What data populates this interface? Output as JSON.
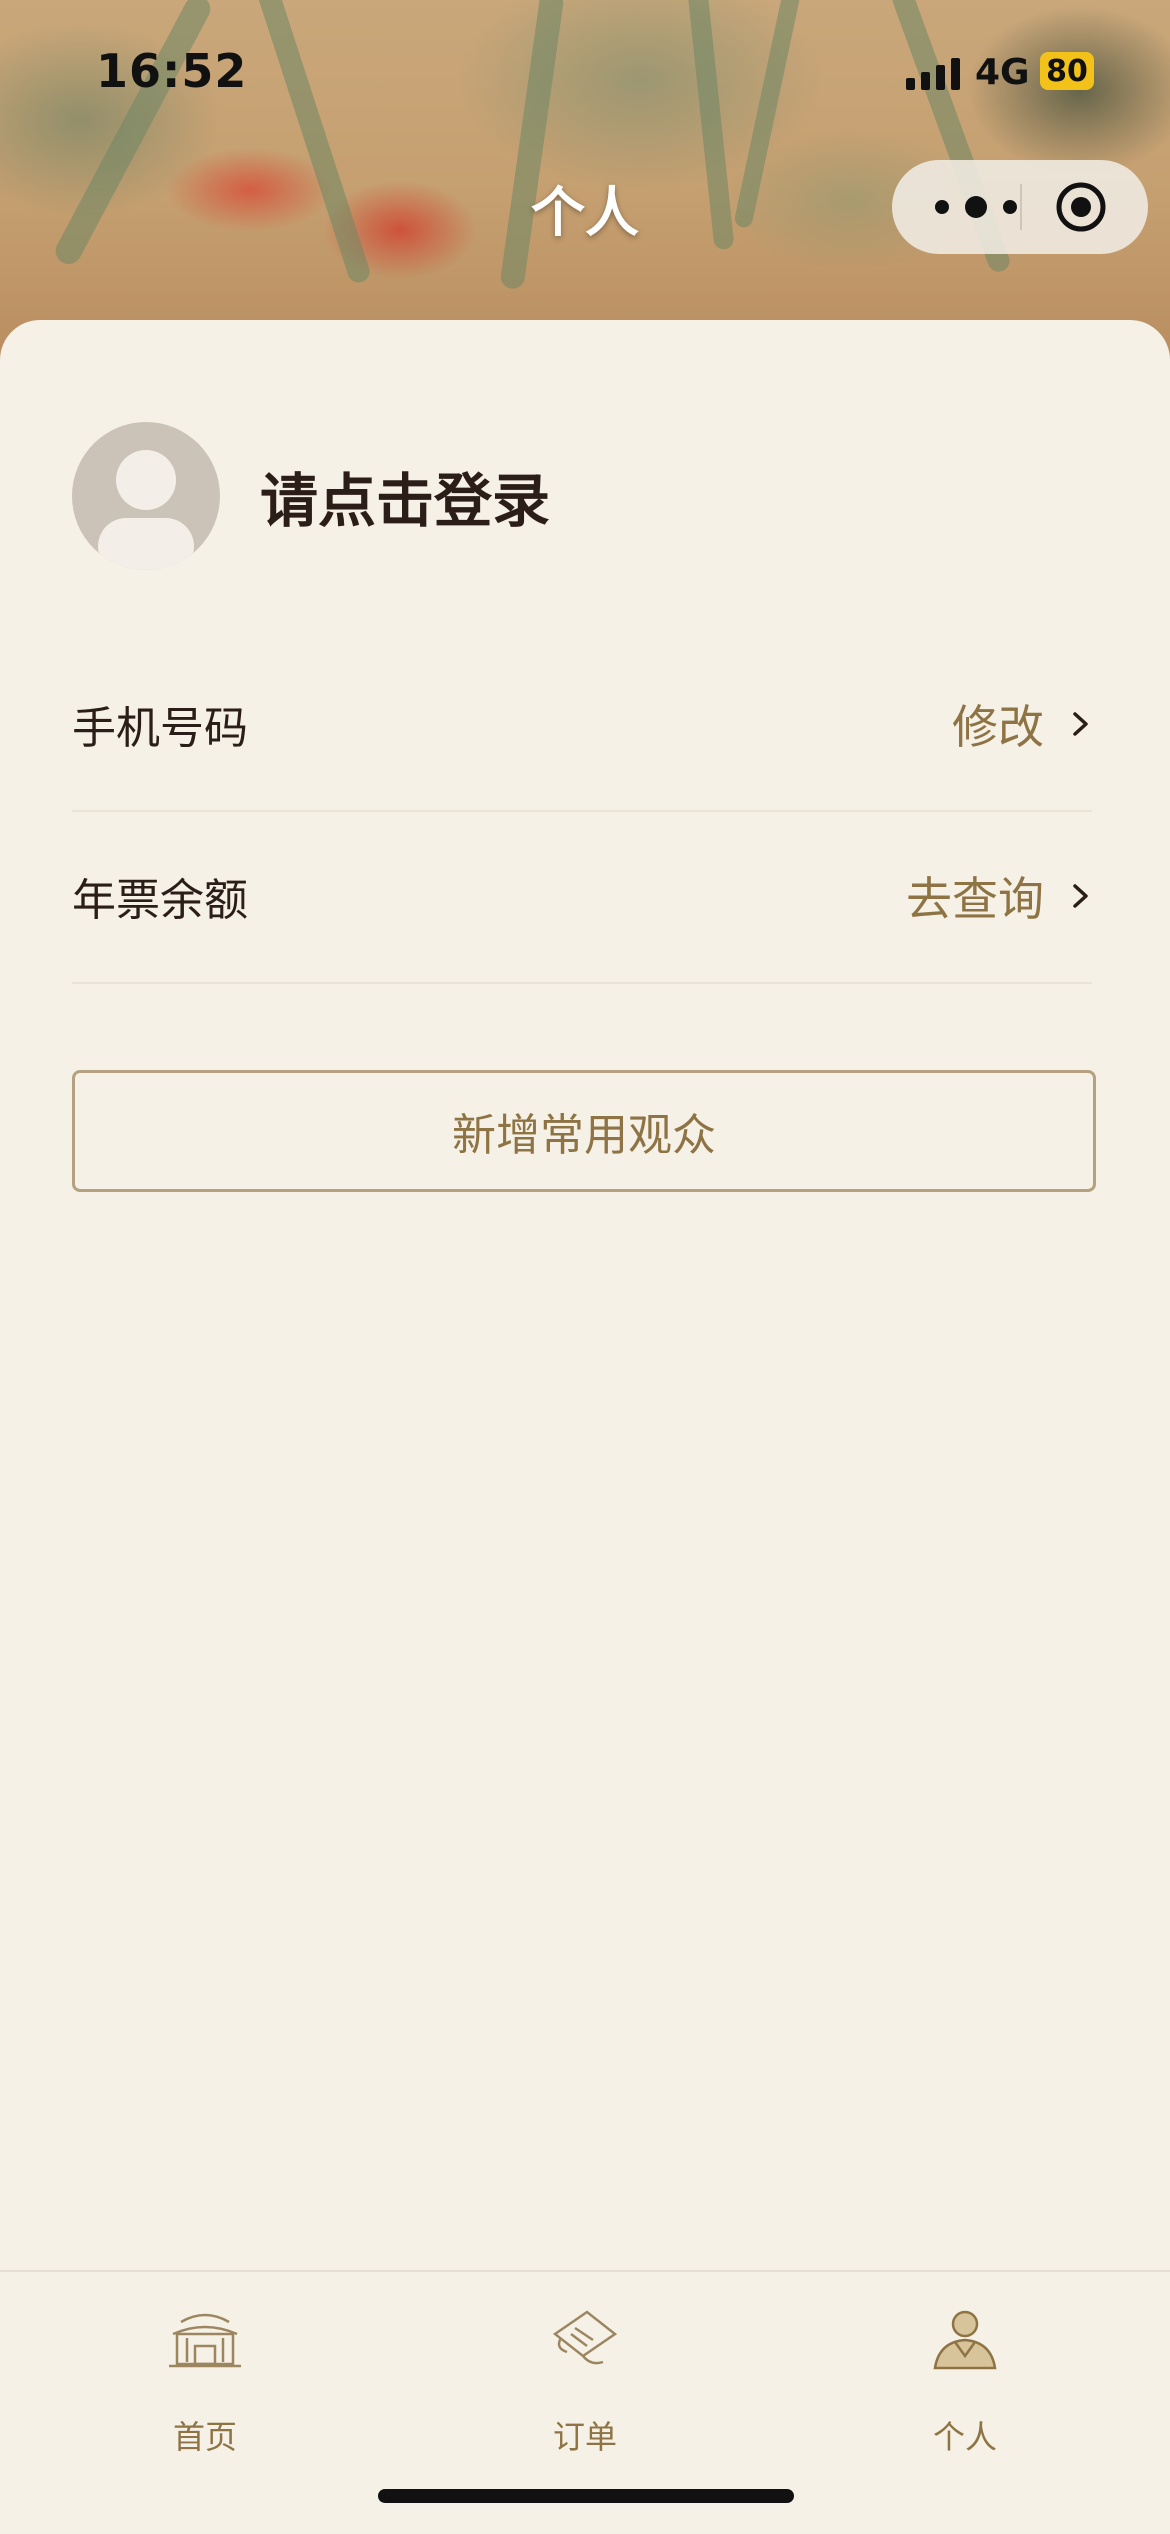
{
  "status_bar": {
    "time": "16:52",
    "network": "4G",
    "battery": "80"
  },
  "nav": {
    "title": "个人",
    "capsule": {
      "more_icon": "more-dots-icon",
      "close_icon": "target-circle-icon"
    }
  },
  "profile": {
    "login_text": "请点击登录",
    "avatar_icon": "default-avatar-icon"
  },
  "rows": [
    {
      "label": "手机号码",
      "action": "修改"
    },
    {
      "label": "年票余额",
      "action": "去查询"
    }
  ],
  "add_button": "新增常用观众",
  "tabbar": {
    "items": [
      {
        "label": "首页",
        "icon": "palace-gate-icon"
      },
      {
        "label": "订单",
        "icon": "scroll-icon"
      },
      {
        "label": "个人",
        "icon": "person-icon"
      }
    ],
    "active_index": 2
  },
  "colors": {
    "accent": "#8e7444",
    "background": "#f6f1e7",
    "text": "#2b1d17"
  }
}
